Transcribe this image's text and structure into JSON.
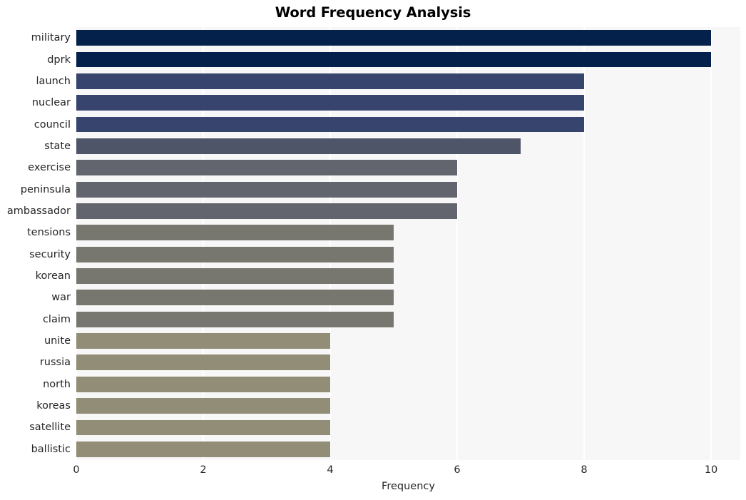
{
  "chart_data": {
    "type": "bar",
    "orientation": "horizontal",
    "title": "Word Frequency Analysis",
    "xlabel": "Frequency",
    "ylabel": "",
    "xlim": [
      0,
      10.46
    ],
    "xticks": [
      0,
      2,
      4,
      6,
      8,
      10
    ],
    "xtick_labels": [
      "0",
      "2",
      "4",
      "6",
      "8",
      "10"
    ],
    "grid": true,
    "grid_axis": "x",
    "grid_color": "#ffffff",
    "plot_background": "#f7f7f7",
    "figure_background": "#ffffff",
    "legend": "none",
    "categories": [
      "military",
      "dprk",
      "launch",
      "nuclear",
      "council",
      "state",
      "exercise",
      "peninsula",
      "ambassador",
      "tensions",
      "security",
      "korean",
      "war",
      "claim",
      "unite",
      "russia",
      "north",
      "koreas",
      "satellite",
      "ballistic"
    ],
    "values": [
      10,
      10,
      8,
      8,
      8,
      7,
      6,
      6,
      6,
      5,
      5,
      5,
      5,
      5,
      4,
      4,
      4,
      4,
      4,
      4
    ],
    "bar_colors": [
      "#03214a",
      "#03214a",
      "#37456e",
      "#37456e",
      "#37456e",
      "#4e5569",
      "#62656e",
      "#62656e",
      "#62656e",
      "#78776f",
      "#78776f",
      "#78776f",
      "#78776f",
      "#78776f",
      "#928d76",
      "#928d76",
      "#928d76",
      "#928d76",
      "#928d76",
      "#928d76"
    ]
  }
}
